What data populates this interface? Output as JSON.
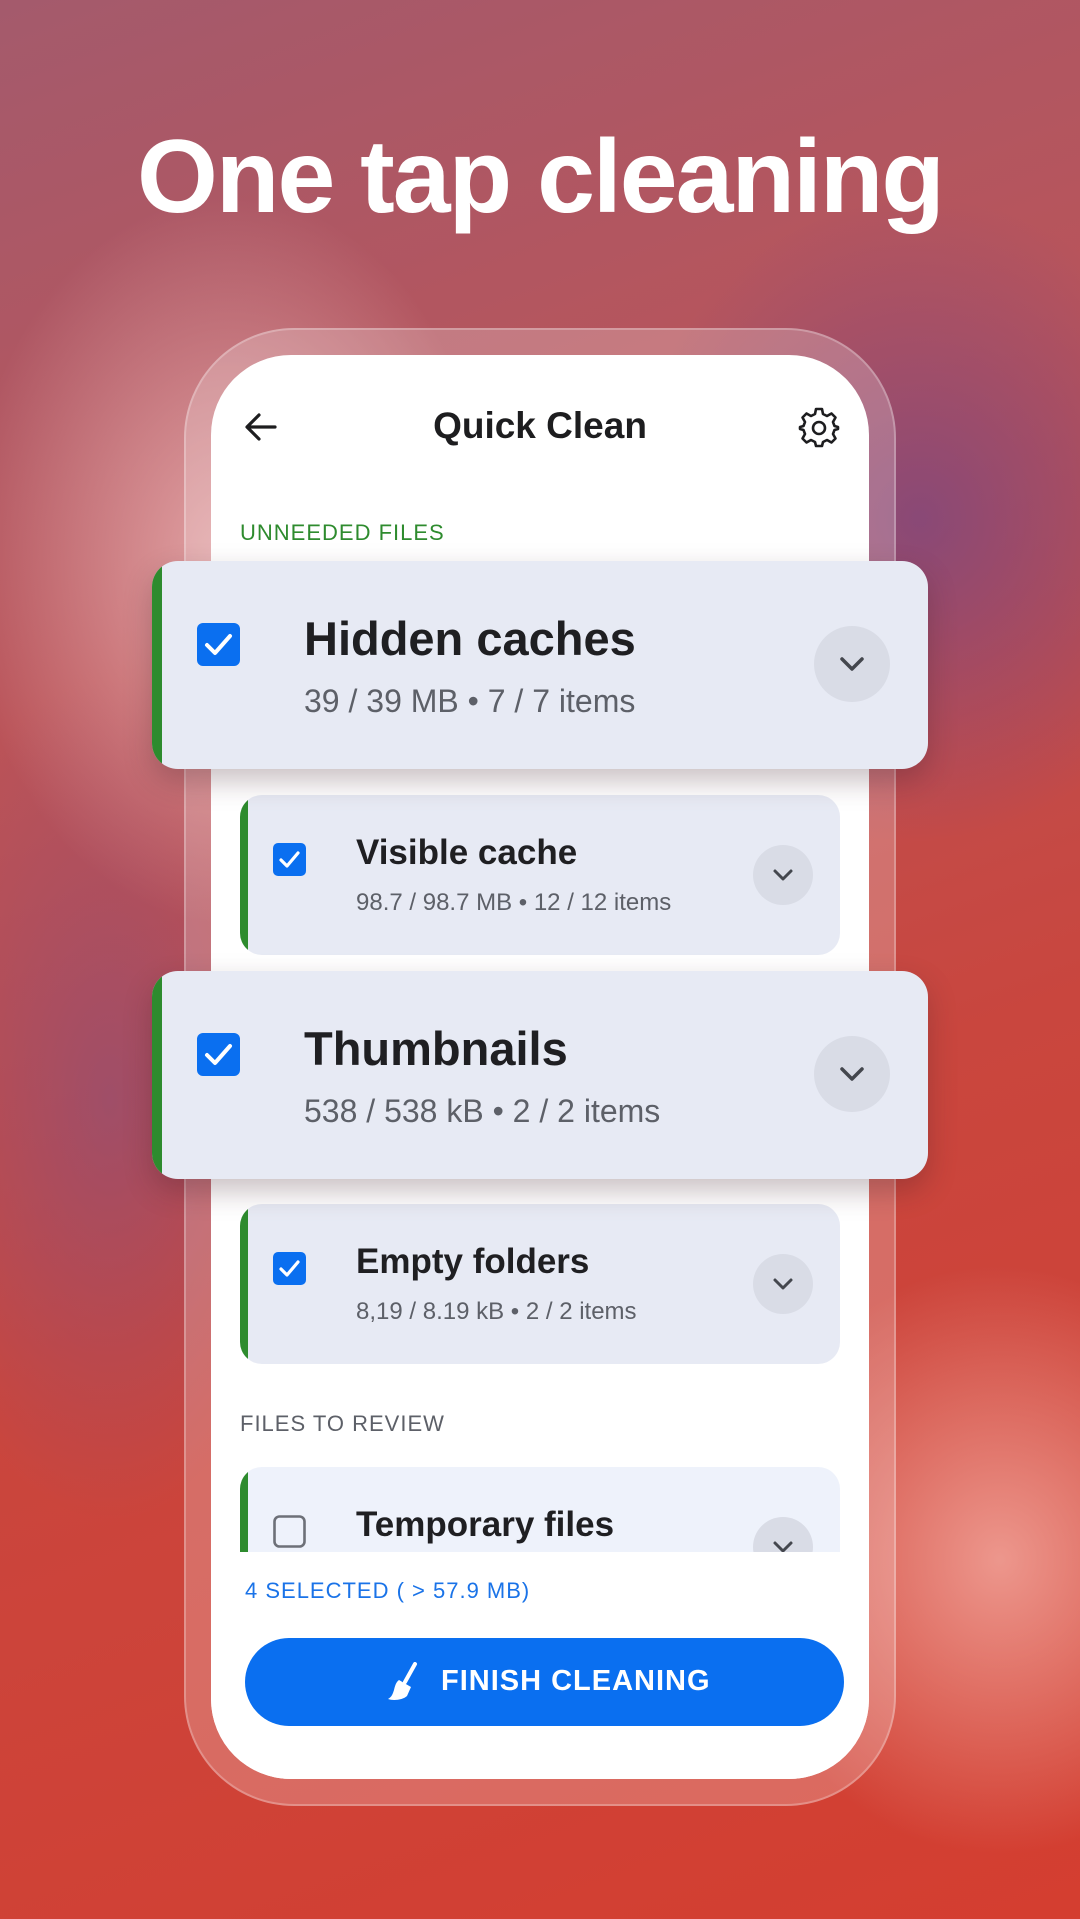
{
  "headline": "One tap cleaning",
  "app": {
    "title": "Quick Clean",
    "back_icon": "arrow-left-icon",
    "settings_icon": "gear-icon"
  },
  "sections": {
    "unneeded": "UNNEEDED FILES",
    "review": "FILES TO REVIEW"
  },
  "items": [
    {
      "title": "Hidden caches",
      "subtitle": "39 / 39 MB • 7 / 7 items",
      "checked": true
    },
    {
      "title": "Visible cache",
      "subtitle": "98.7 / 98.7 MB • 12 / 12 items",
      "checked": true
    },
    {
      "title": "Thumbnails",
      "subtitle": "538 / 538 kB • 2 / 2 items",
      "checked": true
    },
    {
      "title": "Empty folders",
      "subtitle": "8,19 / 8.19 kB • 2 / 2 items",
      "checked": true
    },
    {
      "title": "Temporary files",
      "subtitle": "",
      "checked": false
    }
  ],
  "footer": {
    "selected": "4 SELECTED ( > 57.9 MB)",
    "finish_label": "FINISH CLEANING"
  },
  "colors": {
    "accent_green": "#2e8b2e",
    "primary_blue": "#0a6ff0",
    "label_green": "#2e8b2e",
    "label_gray": "#5d6068"
  }
}
